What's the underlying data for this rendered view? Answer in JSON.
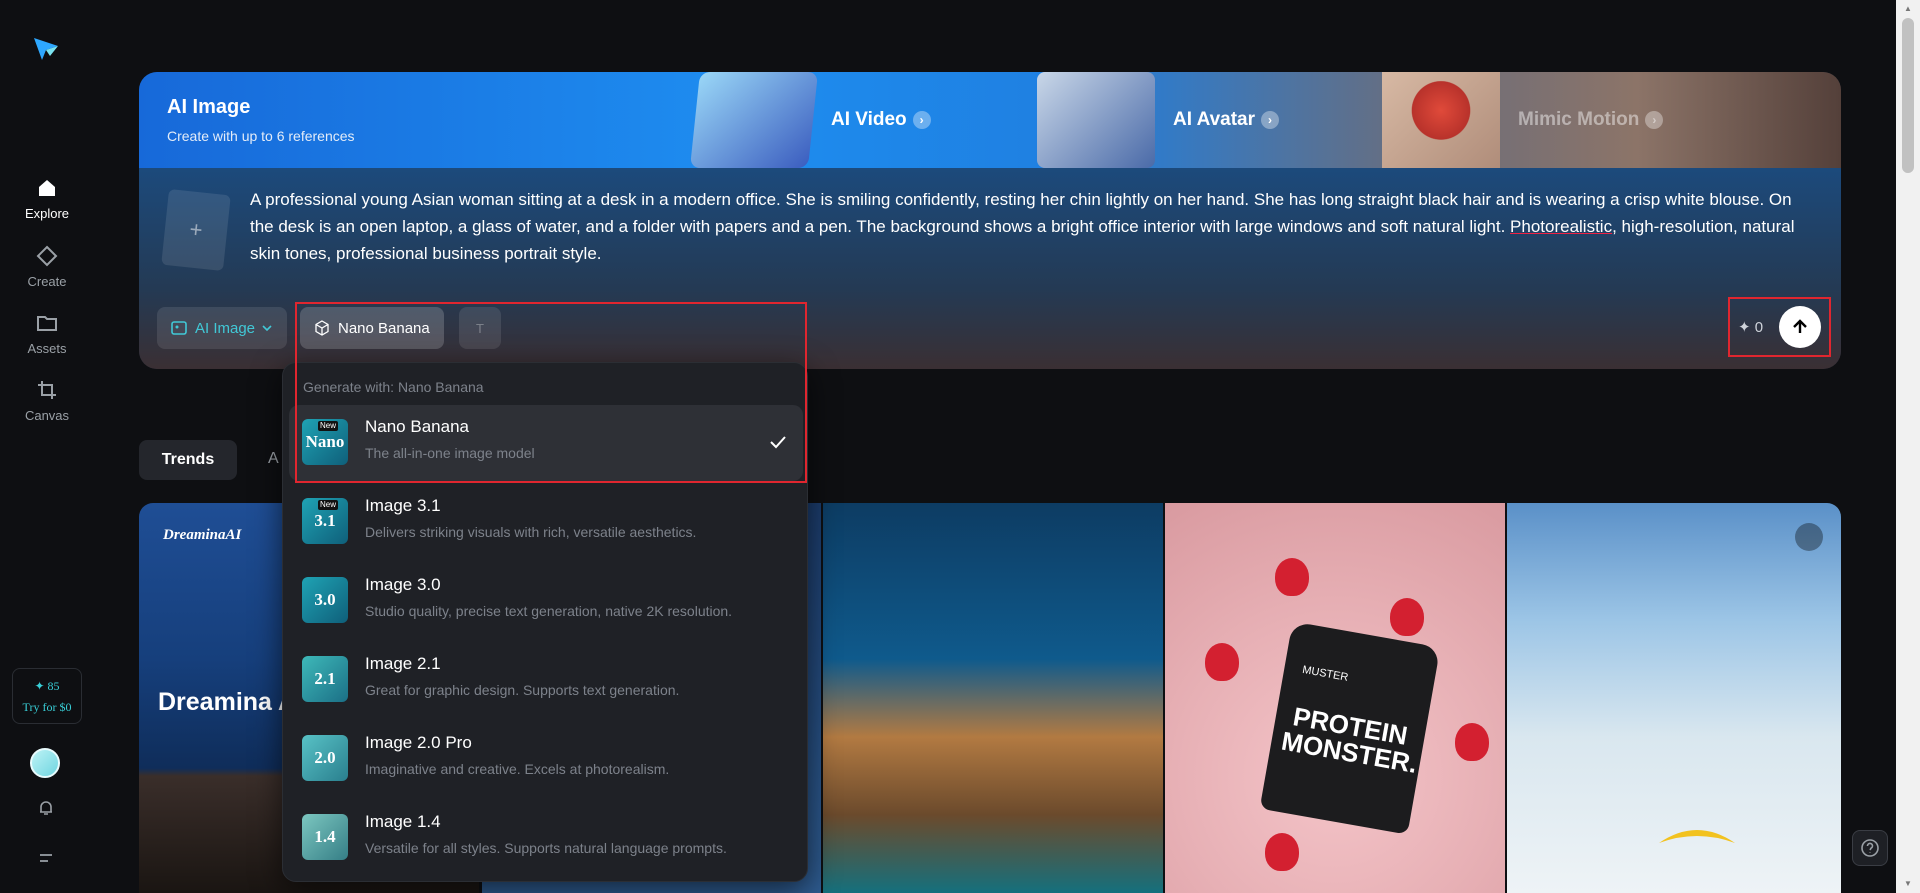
{
  "sidebar": {
    "items": [
      {
        "label": "Explore"
      },
      {
        "label": "Create"
      },
      {
        "label": "Assets"
      },
      {
        "label": "Canvas"
      }
    ],
    "credits": {
      "amount": "✦ 85",
      "promo": "Try for $0"
    }
  },
  "hero": {
    "title": "AI Image",
    "subtitle": "Create with up to 6 references",
    "tabs": [
      {
        "label": "AI Video"
      },
      {
        "label": "AI Avatar"
      },
      {
        "label": "Mimic Motion"
      }
    ]
  },
  "prompt": {
    "text_before": "A professional young Asian woman sitting at a desk in a modern office. She is smiling confidently, resting her chin lightly on her hand. She has long straight black hair and is wearing a crisp white blouse. On the desk is an open laptop, a glass of water, and a folder with papers and a pen. The background shows a bright office interior with large windows and soft natural light. ",
    "underlined": "Photorealistic",
    "text_after": ", high-resolution, natural skin tones, professional business portrait style.",
    "add_reference": "+"
  },
  "toolbar": {
    "mode_label": "AI Image",
    "model_label": "Nano Banana",
    "text_tool": "T",
    "credit_count": "✦ 0"
  },
  "feed": {
    "tab_active": "Trends",
    "tab_other": "A",
    "cards": [
      {
        "brand": "DreaminaAI",
        "title": "Dreamina A"
      },
      {},
      {},
      {
        "product": "PROTEIN MONSTER.",
        "maker": "MUSTER"
      },
      {}
    ]
  },
  "dropdown": {
    "header": "Generate with: Nano Banana",
    "models": [
      {
        "name": "Nano Banana",
        "desc": "The all-in-one image model",
        "thumb": "Nano",
        "badge": "New",
        "selected": true
      },
      {
        "name": "Image 3.1",
        "desc": "Delivers striking visuals with rich, versatile aesthetics.",
        "thumb": "3.1",
        "badge": "New",
        "selected": false
      },
      {
        "name": "Image 3.0",
        "desc": "Studio quality, precise text generation, native 2K resolution.",
        "thumb": "3.0",
        "badge": "",
        "selected": false
      },
      {
        "name": "Image 2.1",
        "desc": "Great for graphic design. Supports text generation.",
        "thumb": "2.1",
        "badge": "",
        "selected": false
      },
      {
        "name": "Image 2.0 Pro",
        "desc": "Imaginative and creative. Excels at photorealism.",
        "thumb": "2.0",
        "badge": "",
        "selected": false
      },
      {
        "name": "Image 1.4",
        "desc": "Versatile for all styles. Supports natural language prompts.",
        "thumb": "1.4",
        "badge": "",
        "selected": false
      }
    ]
  },
  "colors": {
    "accent": "#41c8d6",
    "highlight": "#e0262f",
    "background": "#0e0f12"
  }
}
